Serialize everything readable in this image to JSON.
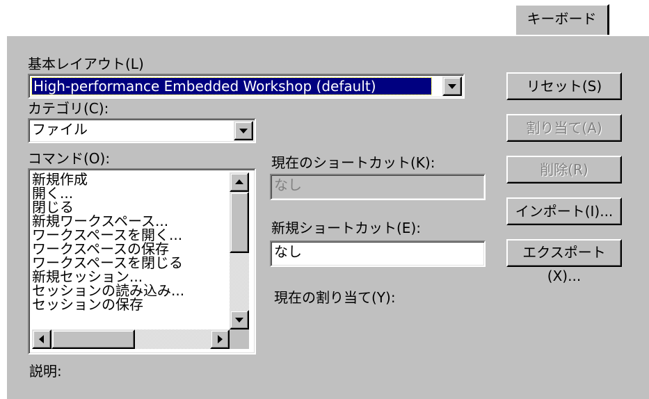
{
  "tab": {
    "label": "キーボード"
  },
  "layout": {
    "label": "基本レイアウト(L)",
    "selected": "High-performance Embedded Workshop (default)"
  },
  "category": {
    "label": "カテゴリ(C):",
    "selected": "ファイル"
  },
  "commands": {
    "label": "コマンド(O):",
    "items": [
      "新規作成",
      "開く...",
      "閉じる",
      "新規ワークスペース...",
      "ワークスペースを開く...",
      "ワークスペースの保存",
      "ワークスペースを閉じる",
      "新規セッション...",
      "セッションの読み込み...",
      "セッションの保存"
    ]
  },
  "current_shortcut": {
    "label": "現在のショートカット(K):",
    "value": "なし"
  },
  "new_shortcut": {
    "label": "新規ショートカット(E):",
    "value": "なし"
  },
  "current_assignment": {
    "label": "現在の割り当て(Y):"
  },
  "description": {
    "label": "説明:"
  },
  "buttons": {
    "reset": "リセット(S)",
    "assign": "割り当て(A)",
    "delete": "削除(R)",
    "import": "インポート(I)...",
    "export": "エクスポート(X)..."
  }
}
